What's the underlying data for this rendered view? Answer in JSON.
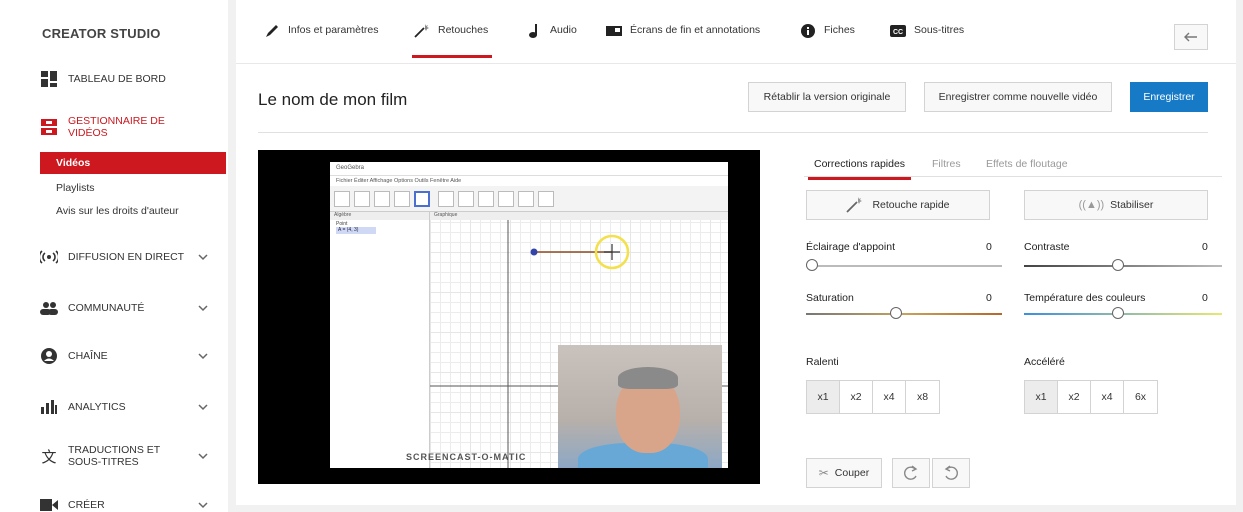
{
  "sidebar": {
    "brand": "CREATOR STUDIO",
    "items": [
      {
        "label": "TABLEAU DE BORD",
        "icon": "dashboard-icon"
      },
      {
        "label": "GESTIONNAIRE DE VIDÉOS",
        "icon": "video-manager-icon"
      },
      {
        "label": "DIFFUSION EN DIRECT",
        "icon": "live-broadcast-icon"
      },
      {
        "label": "COMMUNAUTÉ",
        "icon": "community-icon"
      },
      {
        "label": "CHAÎNE",
        "icon": "channel-icon"
      },
      {
        "label": "ANALYTICS",
        "icon": "analytics-icon"
      },
      {
        "label": "TRADUCTIONS ET SOUS-TITRES",
        "icon": "translate-icon"
      },
      {
        "label": "CRÉER",
        "icon": "create-icon"
      }
    ],
    "subitems": [
      "Vidéos",
      "Playlists",
      "Avis sur les droits d'auteur"
    ],
    "accent": "#cc181e"
  },
  "tabs": [
    {
      "label": "Infos et paramètres",
      "icon": "pencil-icon"
    },
    {
      "label": "Retouches",
      "icon": "magic-wand-icon"
    },
    {
      "label": "Audio",
      "icon": "music-note-icon"
    },
    {
      "label": "Écrans de fin et annotations",
      "icon": "end-screen-icon"
    },
    {
      "label": "Fiches",
      "icon": "info-icon"
    },
    {
      "label": "Sous-titres",
      "icon": "subtitles-icon"
    }
  ],
  "video": {
    "title": "Le nom de mon film",
    "restore_label": "Rétablir la version originale",
    "save_new_label": "Enregistrer comme nouvelle vidéo",
    "save_label": "Enregistrer",
    "watermark": "SCREENCAST-O-MATIC",
    "app_title": "GeoGebra",
    "app_menu": "Fichier Éditer Affichage Options Outils Fenêtre Aide",
    "algebra_header": "Algèbre",
    "graph_header": "Graphique",
    "algebra_point": "Point",
    "algebra_value": "A = (4, 3)"
  },
  "editor": {
    "tabs": [
      "Corrections rapides",
      "Filtres",
      "Effets de floutage"
    ],
    "quick_fix": "Retouche rapide",
    "stabilize": "Stabiliser",
    "fill_light": {
      "label": "Éclairage d'appoint",
      "value": "0"
    },
    "contrast": {
      "label": "Contraste",
      "value": "0"
    },
    "saturation": {
      "label": "Saturation",
      "value": "0"
    },
    "temperature": {
      "label": "Température des couleurs",
      "value": "0"
    },
    "slowmo": {
      "label": "Ralenti",
      "options": [
        "x1",
        "x2",
        "x4",
        "x8"
      ]
    },
    "timelapse": {
      "label": "Accéléré",
      "options": [
        "x1",
        "x2",
        "x4",
        "6x"
      ]
    },
    "trim": "Couper"
  }
}
